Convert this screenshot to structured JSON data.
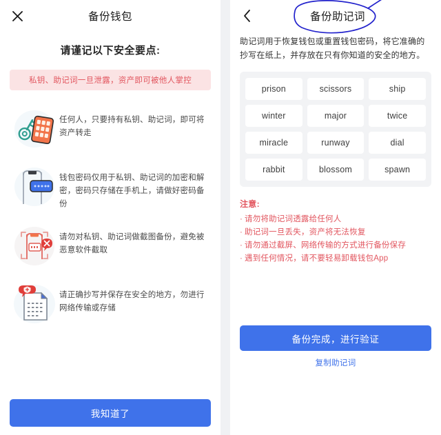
{
  "left_panel": {
    "close_icon": "close-icon",
    "title": "备份钱包",
    "heading": "请谨记以下安全要点:",
    "banner": "私钥、助记词一旦泄露，资产即可被他人掌控",
    "tips": [
      {
        "icon": "key-and-keypad-icon",
        "text": "任何人，只要持有私钥、助记词，即可将资产转走"
      },
      {
        "icon": "phone-password-icon",
        "text": "钱包密码仅用于私钥、助记词的加密和解密，密码只存储在手机上，请做好密码备份"
      },
      {
        "icon": "no-screenshot-icon",
        "text": "请勿对私钥、助记词做截图备份，避免被恶意软件截取"
      },
      {
        "icon": "secure-document-icon",
        "text": "请正确抄写并保存在安全的地方，勿进行网络传输或存储"
      }
    ],
    "know_button": "我知道了"
  },
  "right_panel": {
    "back_icon": "back-chevron-icon",
    "title": "备份助记词",
    "annotation": "hand-drawn-circle-annotation",
    "description": "助记词用于恢复钱包或重置钱包密码，将它准确的抄写在纸上，并存放在只有你知道的安全的地方。",
    "mnemonic_words": [
      "prison",
      "scissors",
      "ship",
      "winter",
      "major",
      "twice",
      "miracle",
      "runway",
      "dial",
      "rabbit",
      "blossom",
      "spawn"
    ],
    "notice_title": "注意:",
    "notice_items": [
      "请勿将助记词透露给任何人",
      "助记词一旦丢失，资产将无法恢复",
      "请勿通过截屏、网络传输的方式进行备份保存",
      "遇到任何情况，请不要轻易卸载钱包App"
    ],
    "notice_bullet": "·",
    "verify_button": "备份完成，进行验证",
    "copy_link": "复制助记词"
  },
  "colors": {
    "primary_blue": "#3f72ea",
    "warning_red": "#e2565f",
    "banner_pink": "#fbe3e4",
    "grid_gray": "#f2f3f5",
    "annotation_blue": "#2222cc"
  }
}
